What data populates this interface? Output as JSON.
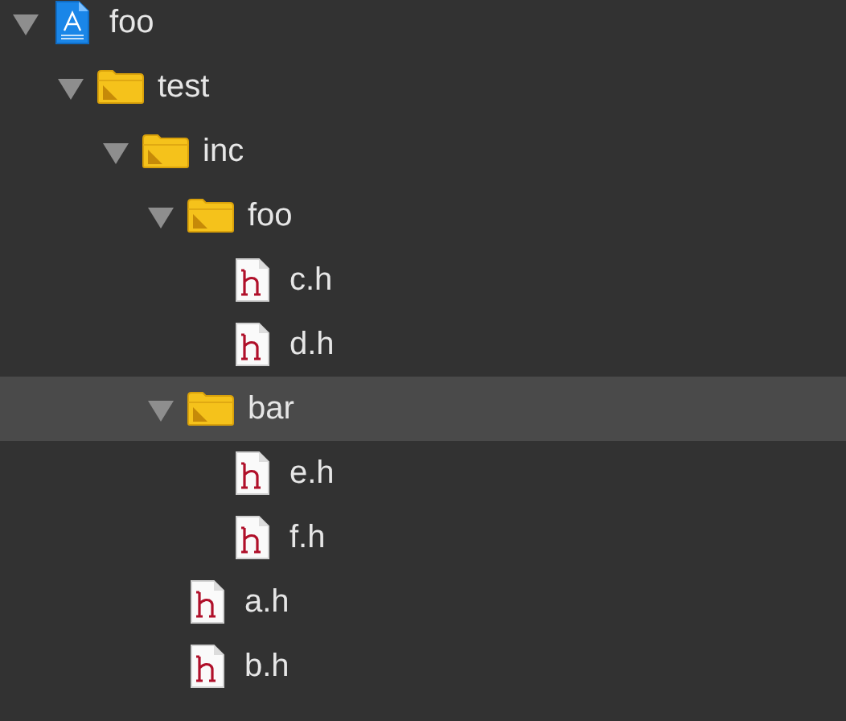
{
  "tree": [
    {
      "label": "foo",
      "kind": "project",
      "expanded": true,
      "selected": false,
      "children": [
        {
          "label": "test",
          "kind": "folder",
          "expanded": true,
          "selected": false,
          "children": [
            {
              "label": "inc",
              "kind": "folder",
              "expanded": true,
              "selected": false,
              "children": [
                {
                  "label": "foo",
                  "kind": "folder",
                  "expanded": true,
                  "selected": false,
                  "children": [
                    {
                      "label": "c.h",
                      "kind": "file",
                      "selected": false
                    },
                    {
                      "label": "d.h",
                      "kind": "file",
                      "selected": false
                    }
                  ]
                },
                {
                  "label": "bar",
                  "kind": "folder",
                  "expanded": true,
                  "selected": true,
                  "children": [
                    {
                      "label": "e.h",
                      "kind": "file",
                      "selected": false
                    },
                    {
                      "label": "f.h",
                      "kind": "file",
                      "selected": false
                    }
                  ]
                },
                {
                  "label": "a.h",
                  "kind": "file",
                  "selected": false
                },
                {
                  "label": "b.h",
                  "kind": "file",
                  "selected": false
                }
              ]
            }
          ]
        }
      ]
    }
  ]
}
